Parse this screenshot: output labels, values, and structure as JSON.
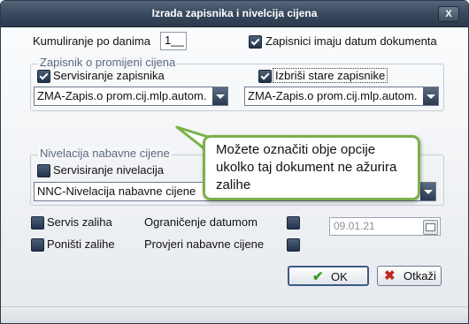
{
  "window": {
    "title": "Izrada zapisnika i nivelcija cijena",
    "close_symbol": "X"
  },
  "top": {
    "cumulation_label": "Kumuliranje po danima",
    "cumulation_value": "1__",
    "document_date": {
      "label": "Zapisnici imaju datum dokumenta",
      "checked": true
    }
  },
  "zapisnik_group": {
    "title": "Zapisnik o promijeni cijena",
    "servicing": {
      "label": "Servisiranje zapisnika",
      "checked": true
    },
    "delete_old": {
      "label": "Izbriši stare zapisnike",
      "checked": true
    },
    "combo_left": "ZMA-Zapis.o prom.cij.mlp.autom.",
    "combo_right": "ZMA-Zapis.o prom.cij.mlp.autom."
  },
  "nivelacija_group": {
    "title": "Nivelacija nabavne cijene",
    "servicing": {
      "label": "Servisiranje nivelacija",
      "checked": false
    },
    "combo": "NNC-Nivelacija nabavne cijene"
  },
  "options": {
    "servis_zaliha": {
      "label": "Servis zaliha",
      "checked": false
    },
    "ponisti_zalihe": {
      "label": "Poništi zalihe",
      "checked": false
    },
    "date_limit": {
      "label": "Ograničenje datumom",
      "checked": false
    },
    "check_purchase": {
      "label": "Provjeri nabavne cijene",
      "checked": false
    },
    "date_value": "09.01.21"
  },
  "buttons": {
    "ok": {
      "label": "OK",
      "icon": "check-icon",
      "color": "#3a9a2a"
    },
    "cancel": {
      "label": "Otkaži",
      "icon": "x-icon",
      "color": "#c0281e"
    }
  },
  "tooltip": {
    "text": "Možete označiti obje opcije ukolko taj dokument ne ažurira zalihe",
    "border_color": "#7bb04a"
  }
}
